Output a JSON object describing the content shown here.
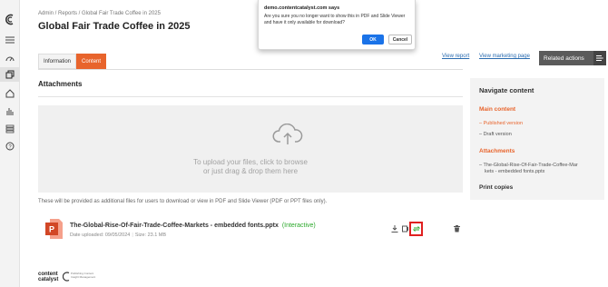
{
  "sidebar": {
    "icons": [
      "logo-icon",
      "menu-icon",
      "dashboard-icon",
      "content-icon",
      "home-icon",
      "analytics-icon",
      "list-icon",
      "help-icon"
    ]
  },
  "header": {
    "breadcrumb": "Admin / Reports / Global Fair Trade Coffee in 2025",
    "title": "Global Fair Trade Coffee in 2025"
  },
  "tabs": [
    {
      "label": "Information"
    },
    {
      "label": "Content"
    }
  ],
  "toolbar": {
    "view_report": "View report",
    "view_marketing": "View marketing page",
    "related_actions": "Related actions"
  },
  "attachments": {
    "heading": "Attachments",
    "upload_line1": "To upload your files, click to browse",
    "upload_line2": "or just drag & drop them here",
    "note": "These will be provided as additional files for users to download or view in PDF and Slide Viewer (PDF or PPT files only).",
    "file": {
      "name": "The-Global-Rise-Of-Fair-Trade-Coffee-Markets - embedded fonts.pptx",
      "tag": "(Interactive)",
      "uploaded": "Date uploaded: 09/05/2024",
      "size": "Size: 23.1 MB"
    }
  },
  "navigate": {
    "heading": "Navigate content",
    "main_content": "Main content",
    "published": "– Published version",
    "draft": "– Draft version",
    "attachments": "Attachments",
    "attach_line1": "– The-Global-Rise-Of-Fair-Trade-Coffee-Mar",
    "attach_line2": "kets - embedded fonts.pptx",
    "print": "Print copies"
  },
  "dialog": {
    "origin": "demo.contentcatalyst.com says",
    "message": "Are you sure you no longer want to show this in PDF and Slide Viewer and have it only available for download?",
    "ok": "OK",
    "cancel": "Cancel"
  },
  "footer": {
    "logo_line1": "content",
    "logo_line2": "catalyst",
    "logo_tagline": "Publishing Content Insight Management"
  },
  "colors": {
    "accent": "#e8642c",
    "link": "#2b6cb0",
    "interactive": "#2aa82a",
    "highlight": "#e02020",
    "ok_button": "#1a73e8"
  }
}
